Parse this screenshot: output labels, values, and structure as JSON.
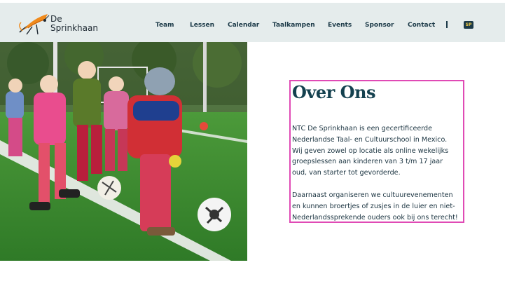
{
  "brand": {
    "name_line1": "De",
    "name_line2": "Sprinkhaan",
    "logo_icon": "grasshopper-icon"
  },
  "nav": {
    "items": [
      "Team",
      "Lessen",
      "Calendar",
      "Taalkampen",
      "Events",
      "Sponsor",
      "Contact"
    ],
    "language_badge": "SP"
  },
  "hero_image": {
    "description_icon": "children-playing-soccer-photo"
  },
  "about": {
    "title": "Over Ons",
    "paragraph1": "NTC De Sprinkhaan is een gecertificeerde\nNederlandse Taal- en Cultuurschool in Mexico.\n Wij geven zowel op locatie als online wekelijks\ngroepslessen aan kinderen van 3 t/m 17 jaar\noud, van starter tot gevorderde.",
    "paragraph2": "Daarnaast organiseren we cultuurevenementen\nen kunnen broertjes of zusjes in de luier en niet-\nNederlandssprekende ouders ook bij ons terecht!"
  },
  "colors": {
    "header_bg": "#e5ecec",
    "nav_text": "#1c3a48",
    "title": "#14414f",
    "highlight_border": "#e04ab5",
    "logo_orange": "#f08a1c"
  }
}
